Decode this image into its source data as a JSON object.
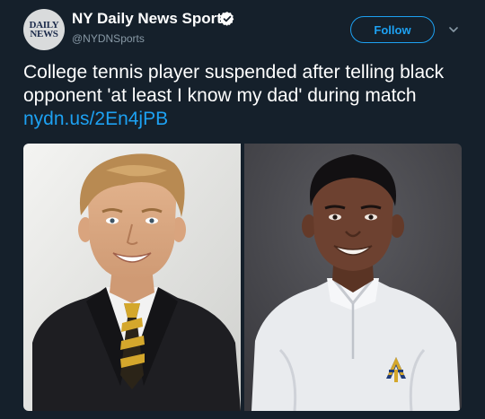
{
  "account": {
    "name": "NY Daily News Sports",
    "handle": "@NYDNSports",
    "logo_line1": "DAILY",
    "logo_line2": "NEWS",
    "verified_icon": "verified-badge-icon"
  },
  "actions": {
    "follow_label": "Follow",
    "menu_icon": "chevron-down-icon"
  },
  "tweet": {
    "text": "College tennis player suspended after telling black opponent 'at least I know my dad' during match ",
    "link": "nydn.us/2En4jPB"
  },
  "media": {
    "photos": [
      "photo-left",
      "photo-right"
    ]
  },
  "colors": {
    "background": "#15202b",
    "accent": "#1da1f2",
    "secondary_text": "#8899a6"
  }
}
